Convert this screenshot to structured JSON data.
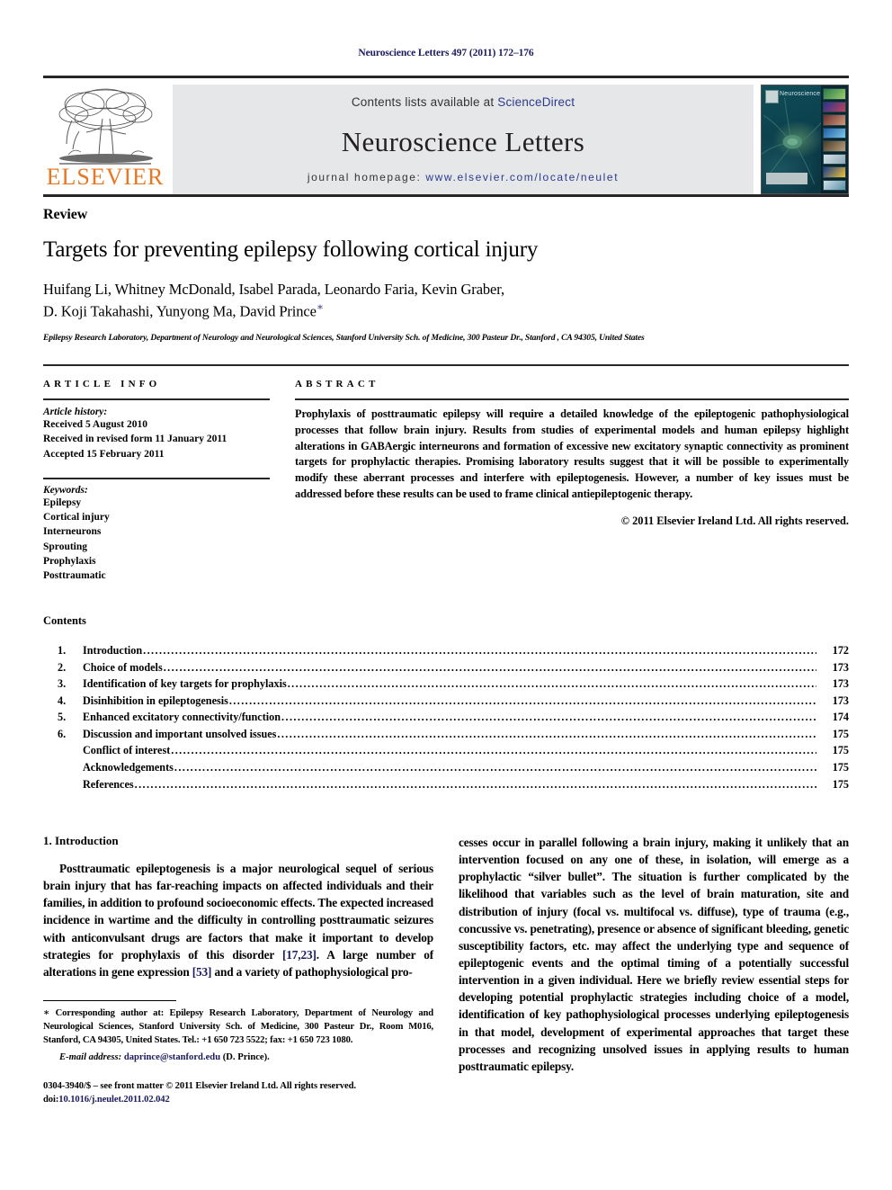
{
  "running_head": "Neuroscience Letters 497 (2011) 172–176",
  "banner": {
    "publisher": "ELSEVIER",
    "contents_prefix": "Contents lists available at",
    "sciencedirect": "ScienceDirect",
    "journal_title": "Neuroscience Letters",
    "homepage_label": "journal homepage:",
    "homepage_url": "www.elsevier.com/locate/neulet",
    "cover_title": "Neuroscience Letters",
    "link_color": "#2b3a8f",
    "banner_bg": "#e6e7e8",
    "elsevier_orange": "#E87722"
  },
  "article": {
    "type": "Review",
    "title": "Targets for preventing epilepsy following cortical injury",
    "authors": "Huifang Li, Whitney McDonald, Isabel Parada, Leonardo Faria, Kevin Graber, D. Koji Takahashi, Yunyong Ma, David Prince",
    "authors_line1": "Huifang Li, Whitney McDonald, Isabel Parada, Leonardo Faria, Kevin Graber,",
    "authors_line2": "D. Koji Takahashi, Yunyong Ma, David Prince",
    "corresponding_marker": "∗",
    "affiliation": "Epilepsy Research Laboratory, Department of Neurology and Neurological Sciences, Stanford University Sch. of Medicine, 300 Pasteur Dr., Stanford , CA 94305, United States"
  },
  "article_info": {
    "heading": "ARTICLE INFO",
    "history_label": "Article history:",
    "history": [
      "Received 5 August 2010",
      "Received in revised form 11 January 2011",
      "Accepted 15 February 2011"
    ],
    "keywords_label": "Keywords:",
    "keywords": [
      "Epilepsy",
      "Cortical injury",
      "Interneurons",
      "Sprouting",
      "Prophylaxis",
      "Posttraumatic"
    ]
  },
  "abstract": {
    "heading": "ABSTRACT",
    "body": "Prophylaxis of posttraumatic epilepsy will require a detailed knowledge of the epileptogenic pathophysiological processes that follow brain injury. Results from studies of experimental models and human epilepsy highlight alterations in GABAergic interneurons and formation of excessive new excitatory synaptic connectivity as prominent targets for prophylactic therapies. Promising laboratory results suggest that it will be possible to experimentally modify these aberrant processes and interfere with epileptogenesis. However, a number of key issues must be addressed before these results can be used to frame clinical antiepileptogenic therapy.",
    "copyright": "© 2011 Elsevier Ireland Ltd. All rights reserved."
  },
  "contents": {
    "heading": "Contents",
    "entries": [
      {
        "num": "1.",
        "label": "Introduction",
        "page": "172",
        "sub": false
      },
      {
        "num": "2.",
        "label": "Choice of models",
        "page": "173",
        "sub": false
      },
      {
        "num": "3.",
        "label": "Identification of key targets for prophylaxis",
        "page": "173",
        "sub": false
      },
      {
        "num": "4.",
        "label": "Disinhibition in epileptogenesis",
        "page": "173",
        "sub": false
      },
      {
        "num": "5.",
        "label": "Enhanced excitatory connectivity/function",
        "page": "174",
        "sub": false
      },
      {
        "num": "6.",
        "label": "Discussion and important unsolved issues",
        "page": "175",
        "sub": false
      },
      {
        "num": "",
        "label": "Conflict of interest",
        "page": "175",
        "sub": true
      },
      {
        "num": "",
        "label": "Acknowledgements",
        "page": "175",
        "sub": true
      },
      {
        "num": "",
        "label": "References",
        "page": "175",
        "sub": true
      }
    ]
  },
  "introduction": {
    "heading": "1. Introduction",
    "para_left": "Posttraumatic epileptogenesis is a major neurological sequel of serious brain injury that has far-reaching impacts on affected individuals and their families, in addition to profound socioeconomic effects. The expected increased incidence in wartime and the difficulty in controlling posttraumatic seizures with anticonvulsant drugs are factors that make it important to develop strategies for prophylaxis of this disorder",
    "ref_1": "[17,23]",
    "para_left_mid": ". A large number of alterations in gene expression",
    "ref_2": "[53]",
    "para_left_end": " and a variety of pathophysiological pro-",
    "para_right": "cesses occur in parallel following a brain injury, making it unlikely that an intervention focused on any one of these, in isolation, will emerge as a prophylactic “silver bullet”. The situation is further complicated by the likelihood that variables such as the level of brain maturation, site and distribution of injury (focal vs. multifocal vs. diffuse), type of trauma (e.g., concussive vs. penetrating), presence or absence of significant bleeding, genetic susceptibility factors, etc. may affect the underlying type and sequence of epileptogenic events and the optimal timing of a potentially successful intervention in a given individual. Here we briefly review essential steps for developing potential prophylactic strategies including choice of a model, identification of key pathophysiological processes underlying epileptogenesis in that model, development of experimental approaches that target these processes and recognizing unsolved issues in applying results to human posttraumatic epilepsy."
  },
  "footnote": {
    "corresponding": "∗ Corresponding author at: Epilepsy Research Laboratory, Department of Neurology and Neurological Sciences, Stanford University Sch. of Medicine, 300 Pasteur Dr., Room M016, Stanford, CA 94305, United States. Tel.: +1 650 723 5522; fax: +1 650 723 1080.",
    "email_label": "E-mail address:",
    "email": "daprince@stanford.edu",
    "email_suffix": "(D. Prince).",
    "issn_line": "0304-3940/$ – see front matter © 2011 Elsevier Ireland Ltd. All rights reserved.",
    "doi_label": "doi:",
    "doi": "10.1016/j.neulet.2011.02.042"
  }
}
